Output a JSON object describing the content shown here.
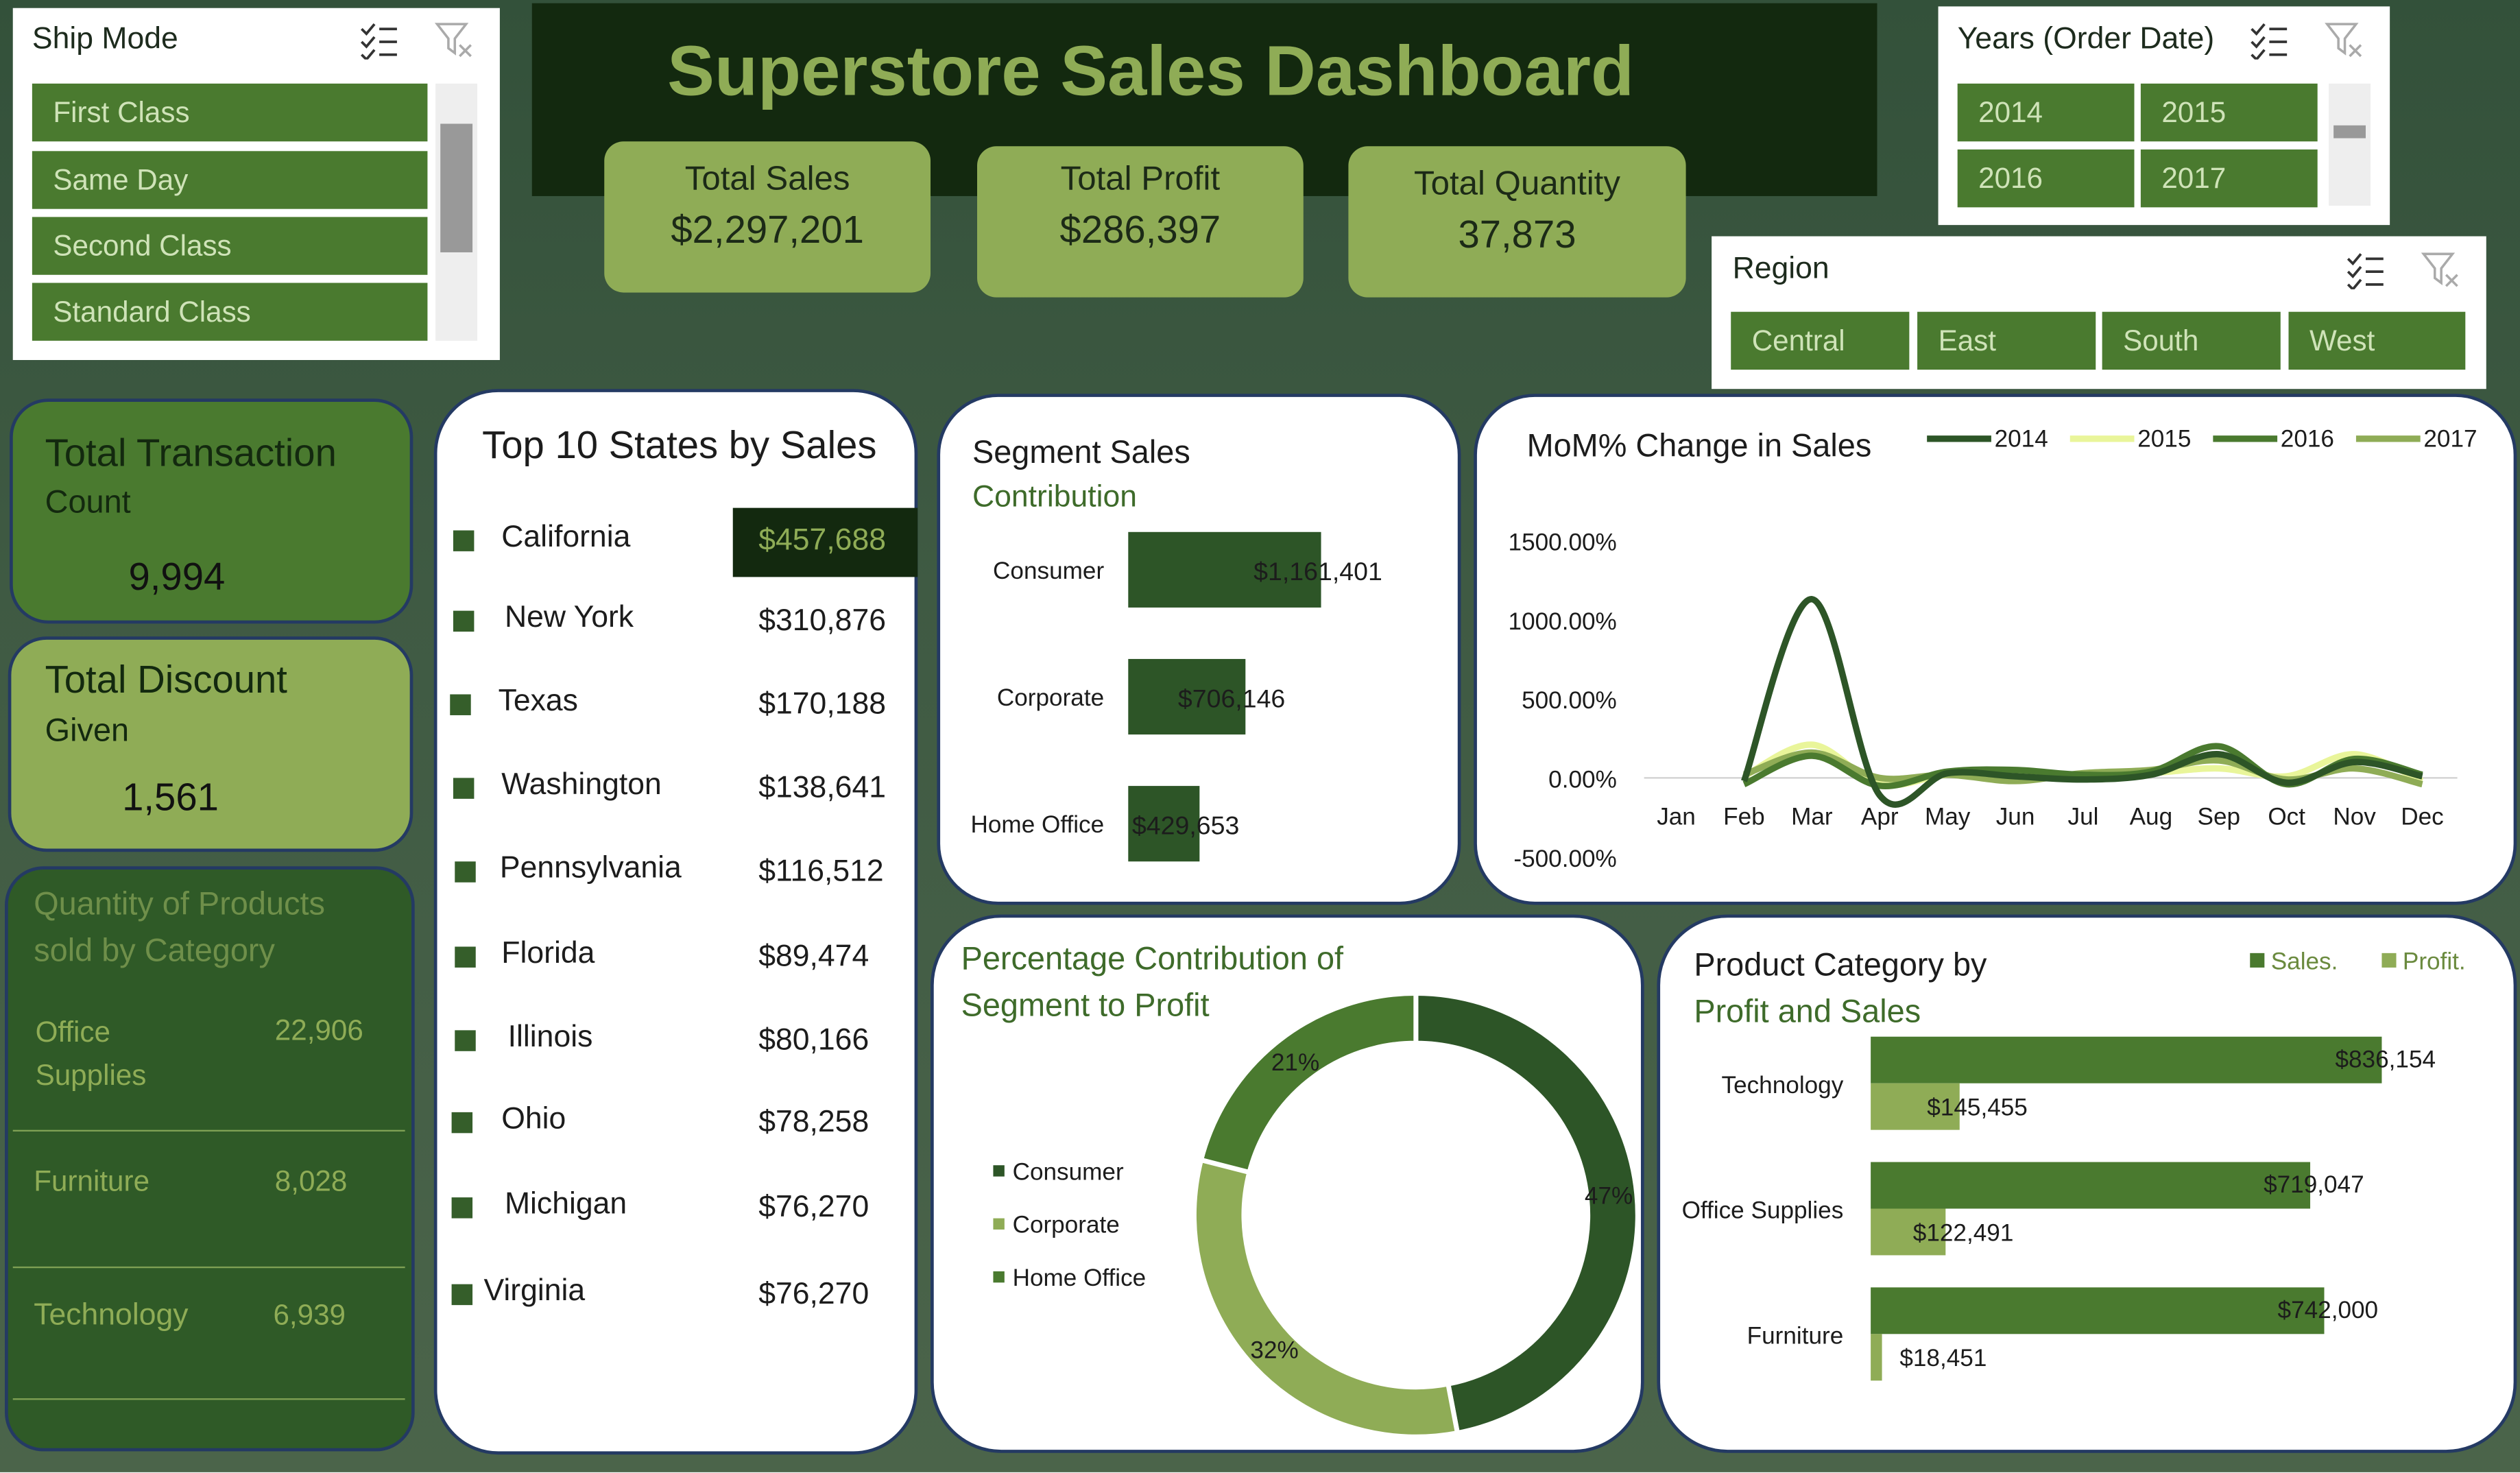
{
  "title": "Superstore Sales Dashboard",
  "ship_mode": {
    "title": "Ship Mode",
    "items": [
      "First Class",
      "Same Day",
      "Second Class",
      "Standard Class"
    ]
  },
  "years": {
    "title": "Years (Order Date)",
    "items": [
      "2014",
      "2015",
      "2016",
      "2017"
    ]
  },
  "region": {
    "title": "Region",
    "items": [
      "Central",
      "East",
      "South",
      "West"
    ]
  },
  "kpis": {
    "sales_label": "Total Sales",
    "sales_value": "$2,297,201",
    "profit_label": "Total Profit",
    "profit_value": "$286,397",
    "quantity_label": "Total Quantity",
    "quantity_value": "37,873"
  },
  "transactions": {
    "title": "Total Transaction",
    "subtitle": "Count",
    "value": "9,994"
  },
  "discount": {
    "title": "Total Discount",
    "subtitle": "Given",
    "value": "1,561"
  },
  "quantity_by_category": {
    "title_line1": "Quantity of Products",
    "title_line2": "sold by Category",
    "rows": [
      {
        "name_line1": "Office",
        "name_line2": "Supplies",
        "value": "22,906"
      },
      {
        "name_line1": "Furniture",
        "name_line2": "",
        "value": "8,028"
      },
      {
        "name_line1": "Technology",
        "name_line2": "",
        "value": "6,939"
      }
    ]
  },
  "top_states": {
    "title": "Top 10 States by Sales",
    "rows": [
      {
        "state": "California",
        "sales": "$457,688"
      },
      {
        "state": "New York",
        "sales": "$310,876"
      },
      {
        "state": "Texas",
        "sales": "$170,188"
      },
      {
        "state": "Washington",
        "sales": "$138,641"
      },
      {
        "state": "Pennsylvania",
        "sales": "$116,512"
      },
      {
        "state": "Florida",
        "sales": "$89,474"
      },
      {
        "state": "Illinois",
        "sales": "$80,166"
      },
      {
        "state": "Ohio",
        "sales": "$78,258"
      },
      {
        "state": "Michigan",
        "sales": "$76,270"
      },
      {
        "state": "Virginia",
        "sales": "$76,270"
      }
    ]
  },
  "colors": {
    "dark": "#2d5527",
    "mid": "#4a7a2f",
    "light": "#8fac56",
    "pale": "#e9f59a",
    "header": "#13290f"
  },
  "chart_data": [
    {
      "id": "segment_sales",
      "type": "bar",
      "title": "Segment Sales",
      "subtitle": "Contribution",
      "categories": [
        "Consumer",
        "Corporate",
        "Home Office"
      ],
      "values": [
        1161401,
        706146,
        429653
      ],
      "labels": [
        "$1,161,401",
        "$706,146",
        "$429,653"
      ],
      "orientation": "horizontal"
    },
    {
      "id": "mom_change",
      "type": "line",
      "title": "MoM% Change in Sales",
      "categories": [
        "Jan",
        "Feb",
        "Mar",
        "Apr",
        "May",
        "Jun",
        "Jul",
        "Aug",
        "Sep",
        "Oct",
        "Nov",
        "Dec"
      ],
      "y_ticks": [
        "1500.00%",
        "1000.00%",
        "500.00%",
        "0.00%",
        "-500.00%"
      ],
      "ylim": [
        -500,
        1500
      ],
      "legend_position": "top",
      "series": [
        {
          "name": "2014",
          "color": "#2d5527",
          "values": [
            null,
            -20,
            1130,
            -110,
            30,
            10,
            -10,
            20,
            150,
            -30,
            100,
            10
          ]
        },
        {
          "name": "2015",
          "color": "#e9f59a",
          "values": [
            null,
            10,
            210,
            -40,
            20,
            10,
            10,
            30,
            60,
            10,
            150,
            -20
          ]
        },
        {
          "name": "2016",
          "color": "#4a7a2f",
          "values": [
            null,
            -40,
            140,
            -50,
            40,
            50,
            20,
            40,
            200,
            -40,
            120,
            20
          ]
        },
        {
          "name": "2017",
          "color": "#8fac56",
          "values": [
            null,
            20,
            160,
            0,
            20,
            -20,
            30,
            50,
            110,
            -10,
            60,
            -40
          ]
        }
      ]
    },
    {
      "id": "segment_profit",
      "type": "pie",
      "title_line1": "Percentage Contribution of",
      "title_line2": "Segment to Profit",
      "categories": [
        "Consumer",
        "Corporate",
        "Home Office"
      ],
      "values": [
        47,
        32,
        21
      ],
      "labels": [
        "47%",
        "32%",
        "21%"
      ],
      "colors": [
        "#2d5527",
        "#8fac56",
        "#4a7a2f"
      ],
      "legend_position": "left"
    },
    {
      "id": "category_profit_sales",
      "type": "bar",
      "title_line1": "Product Category by",
      "title_line2": "Profit and Sales",
      "categories": [
        "Technology",
        "Office Supplies",
        "Furniture"
      ],
      "series": [
        {
          "name": "Sales.",
          "color": "#4a7a2f",
          "values": [
            836154,
            719047,
            742000
          ],
          "labels": [
            "$836,154",
            "$719,047",
            "$742,000"
          ]
        },
        {
          "name": "Profit.",
          "color": "#8fac56",
          "values": [
            145455,
            122491,
            18451
          ],
          "labels": [
            "$145,455",
            "$122,491",
            "$18,451"
          ]
        }
      ],
      "legend_position": "top-right",
      "orientation": "horizontal"
    }
  ]
}
